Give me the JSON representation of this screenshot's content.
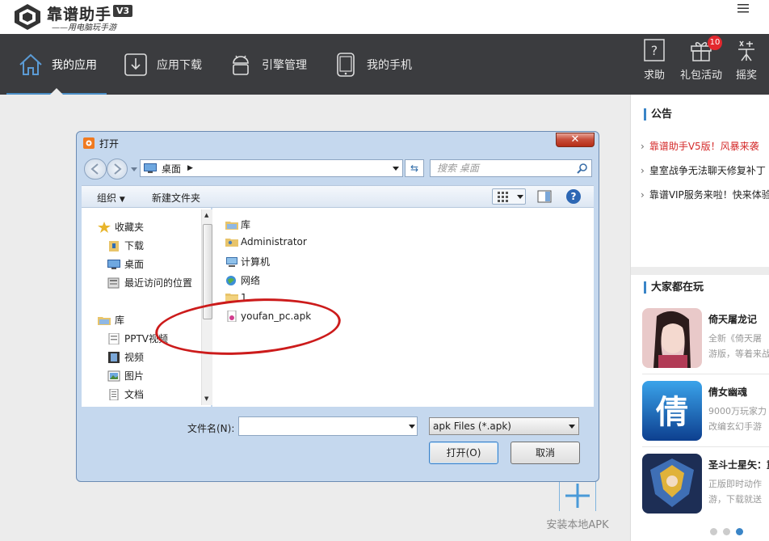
{
  "app": {
    "brand": "靠谱助手",
    "version": "V3",
    "slogan": "——用电脑玩手游"
  },
  "nav": {
    "items": [
      {
        "label": "我的应用",
        "icon": "home-icon",
        "active": true
      },
      {
        "label": "应用下载",
        "icon": "download-icon",
        "active": false
      },
      {
        "label": "引擎管理",
        "icon": "android-icon",
        "active": false
      },
      {
        "label": "我的手机",
        "icon": "phone-icon",
        "active": false
      }
    ],
    "tools": [
      {
        "label": "求助",
        "icon": "help-icon"
      },
      {
        "label": "礼包活动",
        "icon": "gift-icon",
        "badge": "10"
      },
      {
        "label": "摇奖",
        "icon": "lottery-icon"
      }
    ]
  },
  "side": {
    "notice_title": "公告",
    "notices": [
      {
        "text": "靠谱助手V5版！风暴来袭",
        "highlight": true
      },
      {
        "text": "皇室战争无法聊天修复补丁",
        "highlight": false
      },
      {
        "text": "靠谱VIP服务来啦！快来体验",
        "highlight": false
      }
    ],
    "games_title": "大家都在玩",
    "games": [
      {
        "name": "倚天屠龙记",
        "desc1": "全新《倚天屠",
        "desc2": "游版，等着来战"
      },
      {
        "name": "倩女幽魂",
        "desc1": "9000万玩家力",
        "desc2": "改编玄幻手游"
      },
      {
        "name": "圣斗士星矢：重生",
        "desc1": "正版即时动作",
        "desc2": "游，下载就送"
      }
    ]
  },
  "install": {
    "label": "安装本地APK"
  },
  "dialog": {
    "title": "打开",
    "address": "桌面",
    "search_placeholder": "搜索 桌面",
    "toolbar": {
      "organize": "组织",
      "new_folder": "新建文件夹"
    },
    "nav_pane": [
      {
        "label": "收藏夹",
        "icon": "star-icon",
        "indent": 0
      },
      {
        "label": "下载",
        "icon": "downloads-folder-icon",
        "indent": 1
      },
      {
        "label": "桌面",
        "icon": "desktop-icon",
        "indent": 1
      },
      {
        "label": "最近访问的位置",
        "icon": "recent-places-icon",
        "indent": 1
      },
      {
        "label": "库",
        "icon": "library-icon",
        "indent": 0
      },
      {
        "label": "PPTV视频",
        "icon": "video-library-icon",
        "indent": 1
      },
      {
        "label": "视频",
        "icon": "video-icon",
        "indent": 1
      },
      {
        "label": "图片",
        "icon": "pictures-icon",
        "indent": 1
      },
      {
        "label": "文档",
        "icon": "documents-icon",
        "indent": 1
      }
    ],
    "files": [
      {
        "name": "库",
        "icon": "library-icon"
      },
      {
        "name": "Administrator",
        "icon": "user-folder-icon"
      },
      {
        "name": "计算机",
        "icon": "computer-icon"
      },
      {
        "name": "网络",
        "icon": "network-icon"
      },
      {
        "name": "1",
        "icon": "folder-icon"
      },
      {
        "name": "youfan_pc.apk",
        "icon": "apk-file-icon"
      }
    ],
    "filename_label": "文件名(N):",
    "filename_value": "",
    "filetype": "apk Files (*.apk)",
    "open_label": "打开(O)",
    "cancel_label": "取消"
  }
}
